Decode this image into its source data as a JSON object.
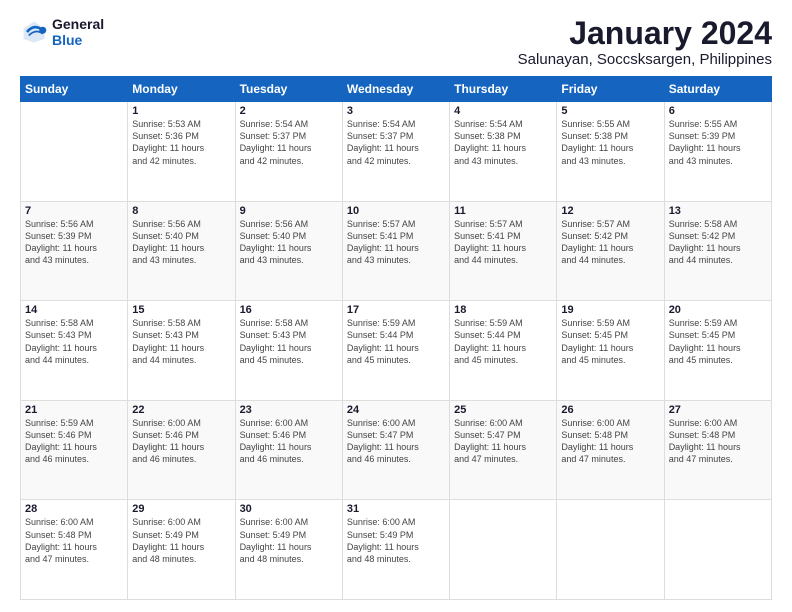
{
  "logo": {
    "line1": "General",
    "line2": "Blue"
  },
  "title": "January 2024",
  "subtitle": "Salunayan, Soccsksargen, Philippines",
  "weekdays": [
    "Sunday",
    "Monday",
    "Tuesday",
    "Wednesday",
    "Thursday",
    "Friday",
    "Saturday"
  ],
  "weeks": [
    [
      {
        "num": "",
        "info": ""
      },
      {
        "num": "1",
        "info": "Sunrise: 5:53 AM\nSunset: 5:36 PM\nDaylight: 11 hours\nand 42 minutes."
      },
      {
        "num": "2",
        "info": "Sunrise: 5:54 AM\nSunset: 5:37 PM\nDaylight: 11 hours\nand 42 minutes."
      },
      {
        "num": "3",
        "info": "Sunrise: 5:54 AM\nSunset: 5:37 PM\nDaylight: 11 hours\nand 42 minutes."
      },
      {
        "num": "4",
        "info": "Sunrise: 5:54 AM\nSunset: 5:38 PM\nDaylight: 11 hours\nand 43 minutes."
      },
      {
        "num": "5",
        "info": "Sunrise: 5:55 AM\nSunset: 5:38 PM\nDaylight: 11 hours\nand 43 minutes."
      },
      {
        "num": "6",
        "info": "Sunrise: 5:55 AM\nSunset: 5:39 PM\nDaylight: 11 hours\nand 43 minutes."
      }
    ],
    [
      {
        "num": "7",
        "info": "Sunrise: 5:56 AM\nSunset: 5:39 PM\nDaylight: 11 hours\nand 43 minutes."
      },
      {
        "num": "8",
        "info": "Sunrise: 5:56 AM\nSunset: 5:40 PM\nDaylight: 11 hours\nand 43 minutes."
      },
      {
        "num": "9",
        "info": "Sunrise: 5:56 AM\nSunset: 5:40 PM\nDaylight: 11 hours\nand 43 minutes."
      },
      {
        "num": "10",
        "info": "Sunrise: 5:57 AM\nSunset: 5:41 PM\nDaylight: 11 hours\nand 43 minutes."
      },
      {
        "num": "11",
        "info": "Sunrise: 5:57 AM\nSunset: 5:41 PM\nDaylight: 11 hours\nand 44 minutes."
      },
      {
        "num": "12",
        "info": "Sunrise: 5:57 AM\nSunset: 5:42 PM\nDaylight: 11 hours\nand 44 minutes."
      },
      {
        "num": "13",
        "info": "Sunrise: 5:58 AM\nSunset: 5:42 PM\nDaylight: 11 hours\nand 44 minutes."
      }
    ],
    [
      {
        "num": "14",
        "info": "Sunrise: 5:58 AM\nSunset: 5:43 PM\nDaylight: 11 hours\nand 44 minutes."
      },
      {
        "num": "15",
        "info": "Sunrise: 5:58 AM\nSunset: 5:43 PM\nDaylight: 11 hours\nand 44 minutes."
      },
      {
        "num": "16",
        "info": "Sunrise: 5:58 AM\nSunset: 5:43 PM\nDaylight: 11 hours\nand 45 minutes."
      },
      {
        "num": "17",
        "info": "Sunrise: 5:59 AM\nSunset: 5:44 PM\nDaylight: 11 hours\nand 45 minutes."
      },
      {
        "num": "18",
        "info": "Sunrise: 5:59 AM\nSunset: 5:44 PM\nDaylight: 11 hours\nand 45 minutes."
      },
      {
        "num": "19",
        "info": "Sunrise: 5:59 AM\nSunset: 5:45 PM\nDaylight: 11 hours\nand 45 minutes."
      },
      {
        "num": "20",
        "info": "Sunrise: 5:59 AM\nSunset: 5:45 PM\nDaylight: 11 hours\nand 45 minutes."
      }
    ],
    [
      {
        "num": "21",
        "info": "Sunrise: 5:59 AM\nSunset: 5:46 PM\nDaylight: 11 hours\nand 46 minutes."
      },
      {
        "num": "22",
        "info": "Sunrise: 6:00 AM\nSunset: 5:46 PM\nDaylight: 11 hours\nand 46 minutes."
      },
      {
        "num": "23",
        "info": "Sunrise: 6:00 AM\nSunset: 5:46 PM\nDaylight: 11 hours\nand 46 minutes."
      },
      {
        "num": "24",
        "info": "Sunrise: 6:00 AM\nSunset: 5:47 PM\nDaylight: 11 hours\nand 46 minutes."
      },
      {
        "num": "25",
        "info": "Sunrise: 6:00 AM\nSunset: 5:47 PM\nDaylight: 11 hours\nand 47 minutes."
      },
      {
        "num": "26",
        "info": "Sunrise: 6:00 AM\nSunset: 5:48 PM\nDaylight: 11 hours\nand 47 minutes."
      },
      {
        "num": "27",
        "info": "Sunrise: 6:00 AM\nSunset: 5:48 PM\nDaylight: 11 hours\nand 47 minutes."
      }
    ],
    [
      {
        "num": "28",
        "info": "Sunrise: 6:00 AM\nSunset: 5:48 PM\nDaylight: 11 hours\nand 47 minutes."
      },
      {
        "num": "29",
        "info": "Sunrise: 6:00 AM\nSunset: 5:49 PM\nDaylight: 11 hours\nand 48 minutes."
      },
      {
        "num": "30",
        "info": "Sunrise: 6:00 AM\nSunset: 5:49 PM\nDaylight: 11 hours\nand 48 minutes."
      },
      {
        "num": "31",
        "info": "Sunrise: 6:00 AM\nSunset: 5:49 PM\nDaylight: 11 hours\nand 48 minutes."
      },
      {
        "num": "",
        "info": ""
      },
      {
        "num": "",
        "info": ""
      },
      {
        "num": "",
        "info": ""
      }
    ]
  ]
}
